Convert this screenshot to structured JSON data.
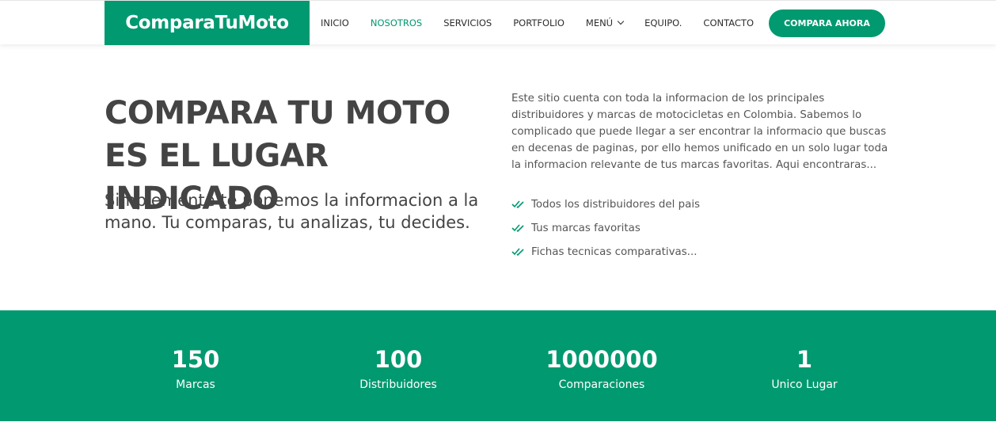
{
  "brand": {
    "name": "ComparaTuMoto",
    "accent_color": "#009970"
  },
  "nav": {
    "items": [
      {
        "label": "INICIO",
        "active": false
      },
      {
        "label": "NOSOTROS",
        "active": true
      },
      {
        "label": "SERVICIOS",
        "active": false
      },
      {
        "label": "PORTFOLIO",
        "active": false
      },
      {
        "label": "MENÚ",
        "active": false,
        "has_dropdown": true
      },
      {
        "label": "EQUIPO.",
        "active": false
      },
      {
        "label": "CONTACTO",
        "active": false
      }
    ],
    "cta_label": "COMPARA AHORA"
  },
  "hero": {
    "title": "COMPARA TU MOTO ES EL LUGAR INDICADO",
    "subtitle": "Simplemente te ponemos la informacion a la mano. Tu comparas, tu analizas, tu decides.",
    "description": "Este sitio cuenta con toda la informacion de los principales distribuidores y marcas de motocicletas en Colombia. Sabemos lo complicado que puede llegar a ser encontrar la informacio que buscas en decenas de paginas, por ello hemos unificado en un solo lugar toda la informacion relevante de tus marcas favoritas. Aqui encontraras...",
    "features": [
      "Todos los distribuidores del pais",
      "Tus marcas favoritas",
      "Fichas tecnicas comparativas..."
    ],
    "feature_icon": "double-check-icon"
  },
  "stats": [
    {
      "value": "150",
      "label": "Marcas"
    },
    {
      "value": "100",
      "label": "Distribuidores"
    },
    {
      "value": "1000000",
      "label": "Comparaciones"
    },
    {
      "value": "1",
      "label": "Unico Lugar"
    }
  ]
}
